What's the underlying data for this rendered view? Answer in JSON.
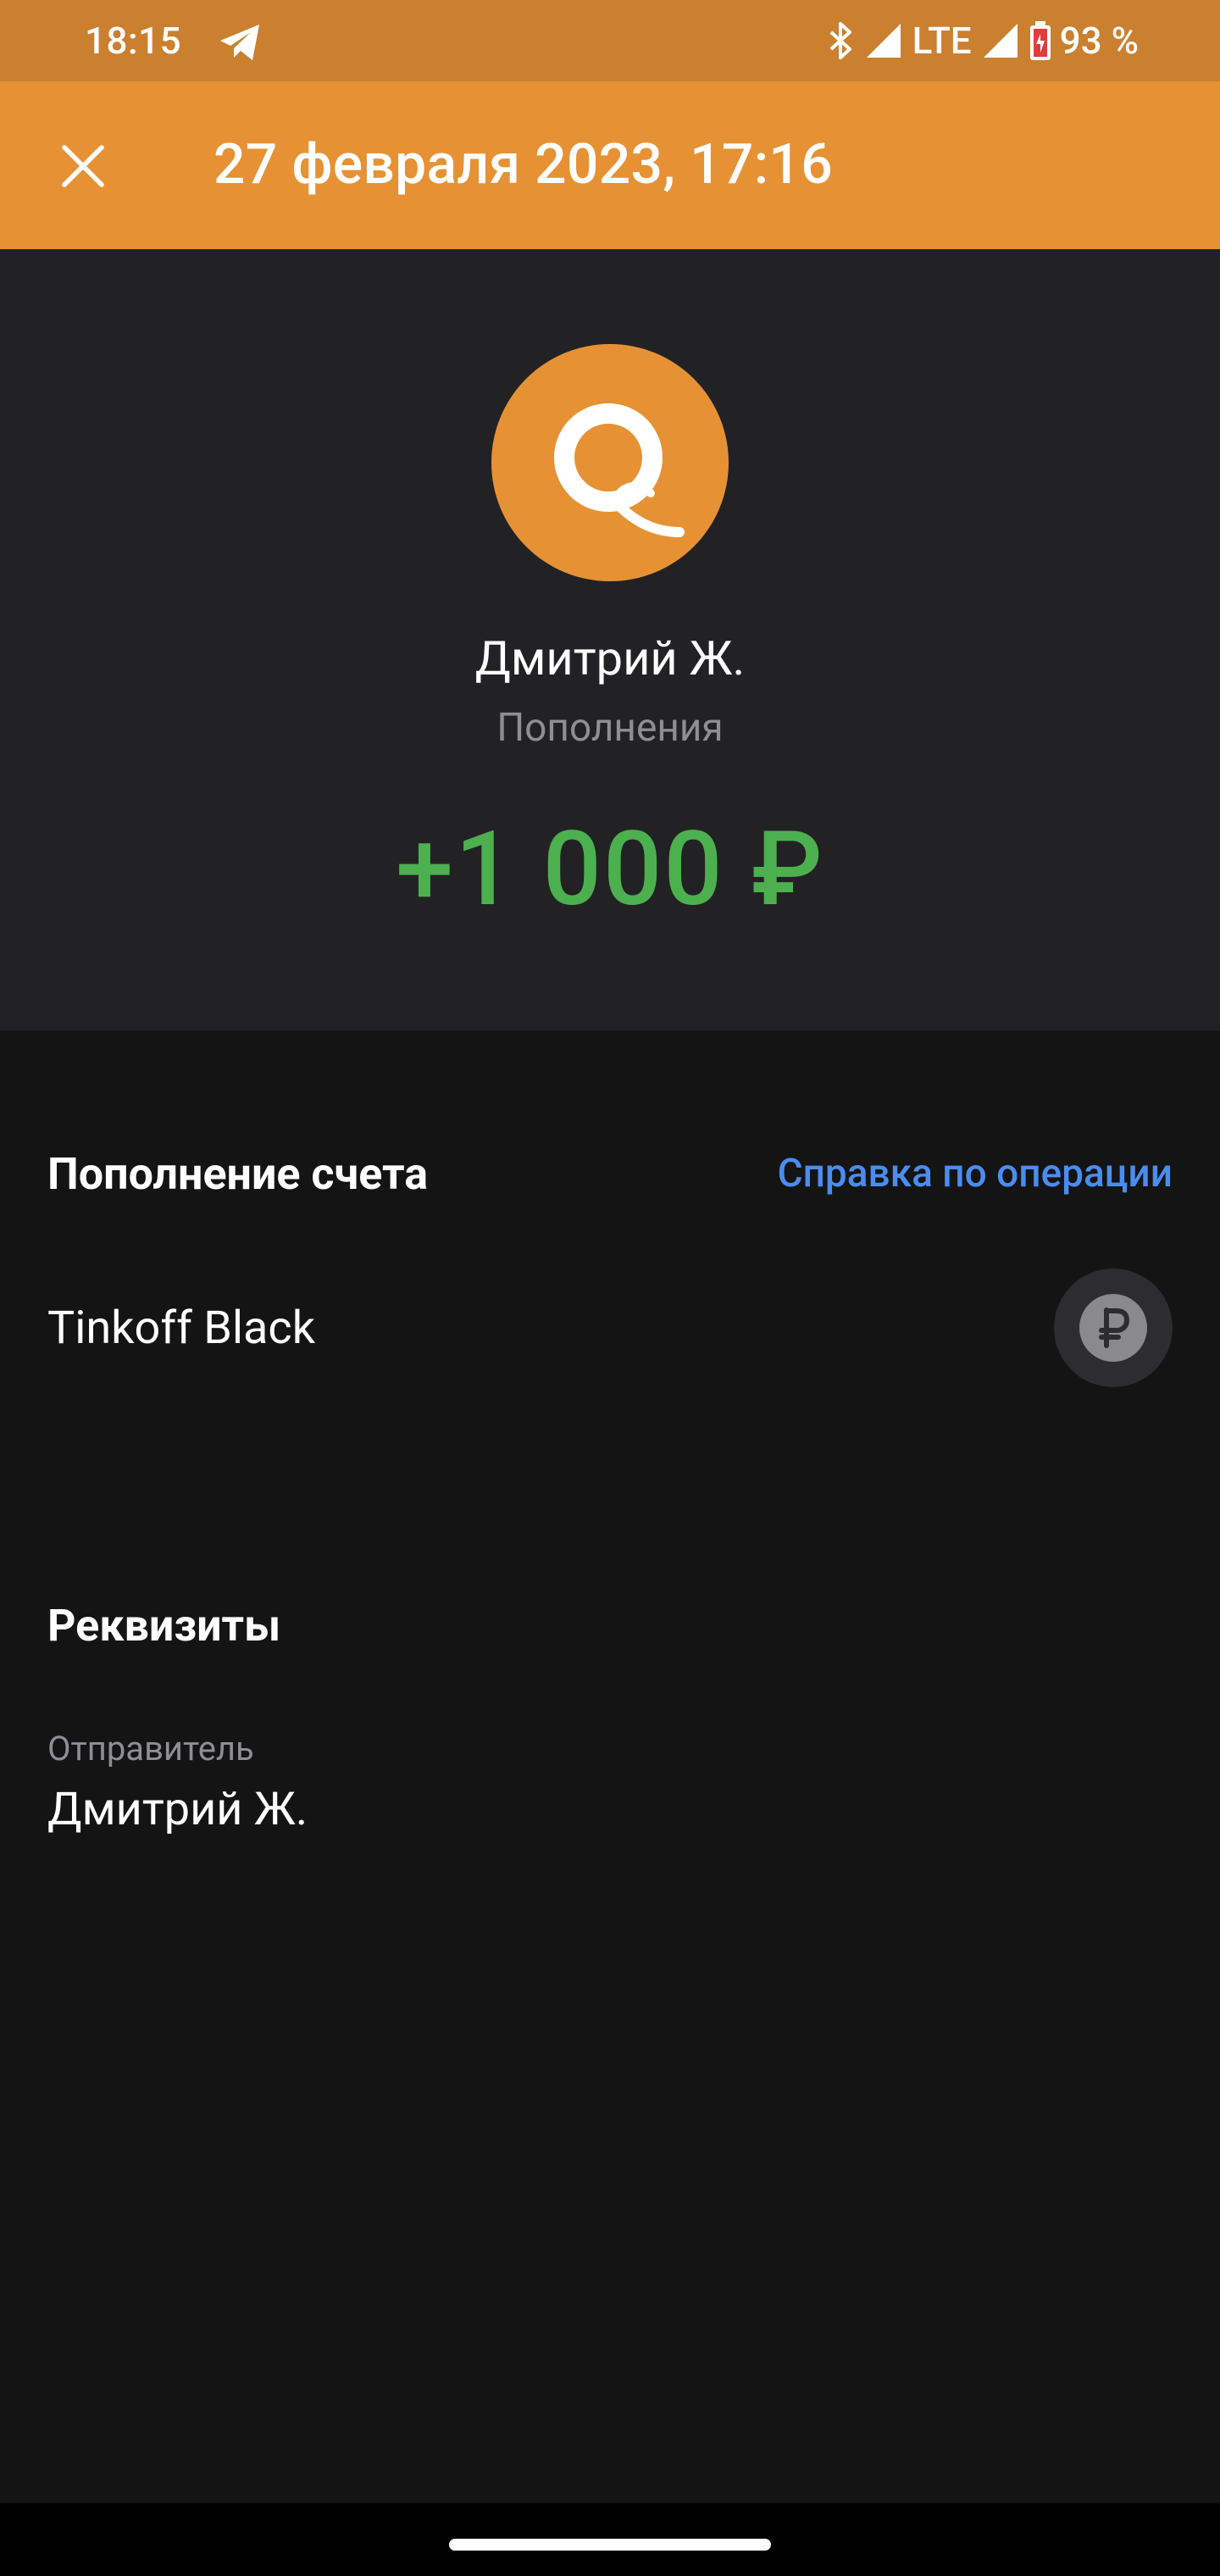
{
  "status_bar": {
    "time": "18:15",
    "network": "LTE",
    "battery": "93 %"
  },
  "app_bar": {
    "title": "27 февраля 2023, 17:16"
  },
  "operation": {
    "counterparty": "Дмитрий Ж.",
    "category": "Пополнения",
    "amount": "+1 000 ₽",
    "amount_color": "#4CB04F",
    "brand_color": "#E69234"
  },
  "details": {
    "section_title": "Пополнение счета",
    "help_link": "Справка по операции",
    "account_name": "Tinkoff Black"
  },
  "requisites": {
    "section_title": "Реквизиты",
    "sender_label": "Отправитель",
    "sender_value": "Дмитрий Ж."
  }
}
